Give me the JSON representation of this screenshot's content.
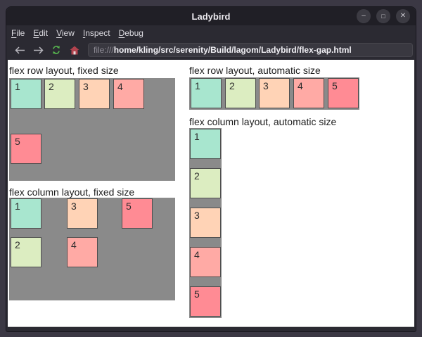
{
  "window": {
    "title": "Ladybird",
    "minimize_glyph": "–",
    "maximize_glyph": "□",
    "close_glyph": "✕"
  },
  "menubar": {
    "items": [
      {
        "mnemonic": "F",
        "rest": "ile"
      },
      {
        "mnemonic": "E",
        "rest": "dit"
      },
      {
        "mnemonic": "V",
        "rest": "iew"
      },
      {
        "mnemonic": "I",
        "rest": "nspect"
      },
      {
        "mnemonic": "D",
        "rest": "ebug"
      }
    ]
  },
  "toolbar": {
    "url": {
      "scheme": "file:///",
      "path": "home/kling/src/serenity/Build/lagom/Ladybird/flex-gap.html"
    }
  },
  "page": {
    "container_color": "#8a8a8a",
    "box_colors": [
      "#a8e6cf",
      "#dcedc1",
      "#ffd3b6",
      "#ffaaa5",
      "#ff8b94"
    ],
    "sections": [
      {
        "title": "flex row layout, fixed size",
        "boxes": [
          "1",
          "2",
          "3",
          "4",
          "5"
        ]
      },
      {
        "title": "flex column layout, fixed size",
        "boxes": [
          "1",
          "2",
          "3",
          "4",
          "5"
        ]
      },
      {
        "title": "flex row layout, automatic size",
        "boxes": [
          "1",
          "2",
          "3",
          "4",
          "5"
        ]
      },
      {
        "title": "flex column layout, automatic size",
        "boxes": [
          "1",
          "2",
          "3",
          "4",
          "5"
        ]
      }
    ]
  }
}
